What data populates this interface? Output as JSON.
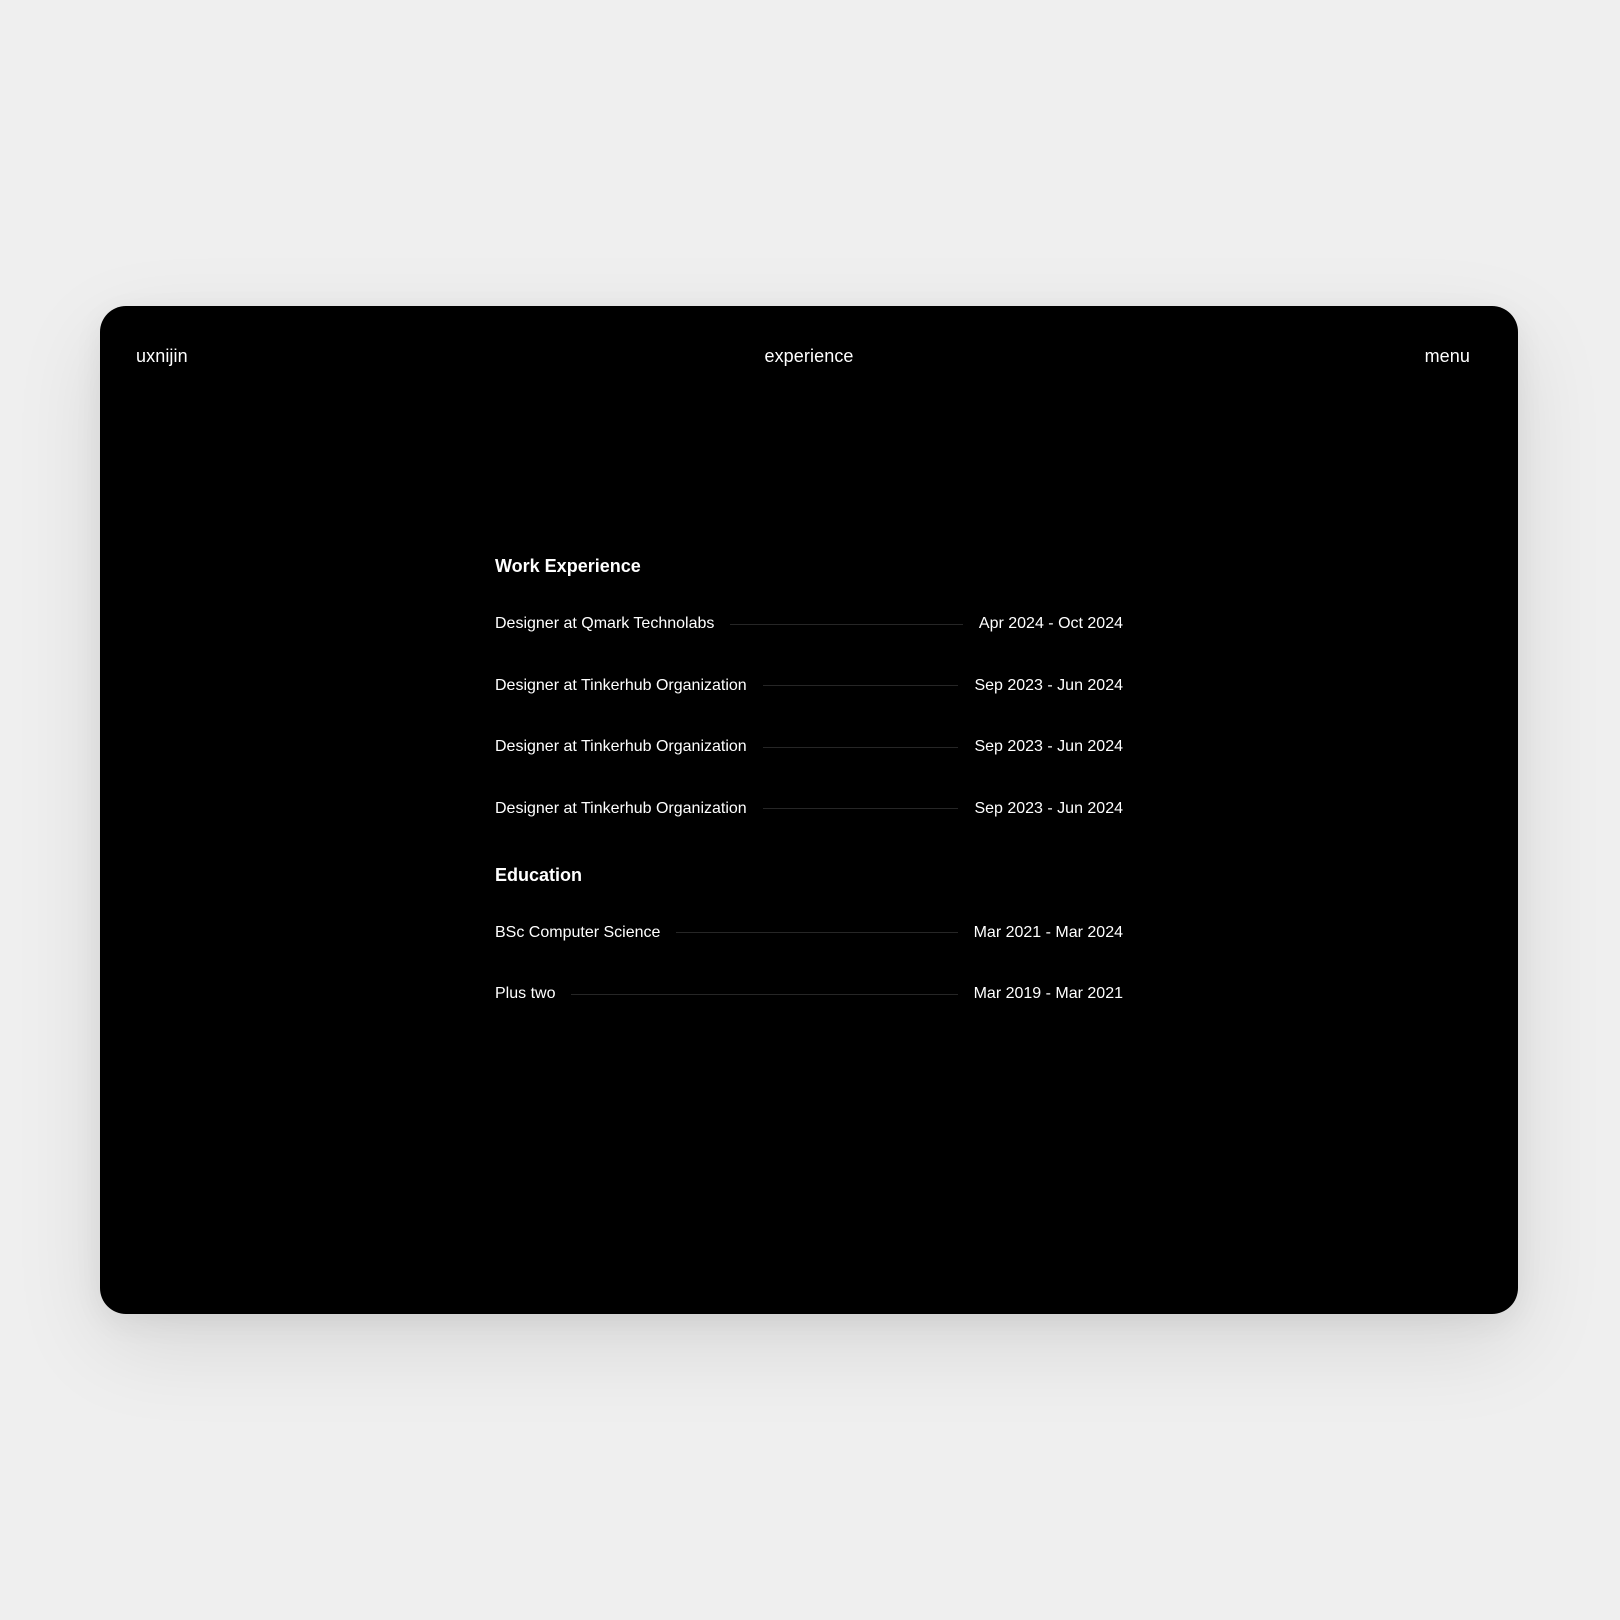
{
  "header": {
    "brand": "uxnijin",
    "title": "experience",
    "menu_label": "menu"
  },
  "work": {
    "heading": "Work Experience",
    "items": [
      {
        "title": "Designer at Qmark Technolabs",
        "dates": "Apr 2024 - Oct 2024"
      },
      {
        "title": "Designer at Tinkerhub Organization",
        "dates": "Sep 2023 - Jun 2024"
      },
      {
        "title": "Designer at Tinkerhub Organization",
        "dates": "Sep 2023 - Jun 2024"
      },
      {
        "title": "Designer at Tinkerhub Organization",
        "dates": "Sep 2023 - Jun 2024"
      }
    ]
  },
  "education": {
    "heading": "Education",
    "items": [
      {
        "title": "BSc Computer Science",
        "dates": "Mar 2021 - Mar 2024"
      },
      {
        "title": "Plus two",
        "dates": "Mar 2019 - Mar 2021"
      }
    ]
  },
  "colors": {
    "page_background": "#efefef",
    "panel_background": "#000000",
    "text": "#ffffff",
    "divider": "#262626"
  }
}
